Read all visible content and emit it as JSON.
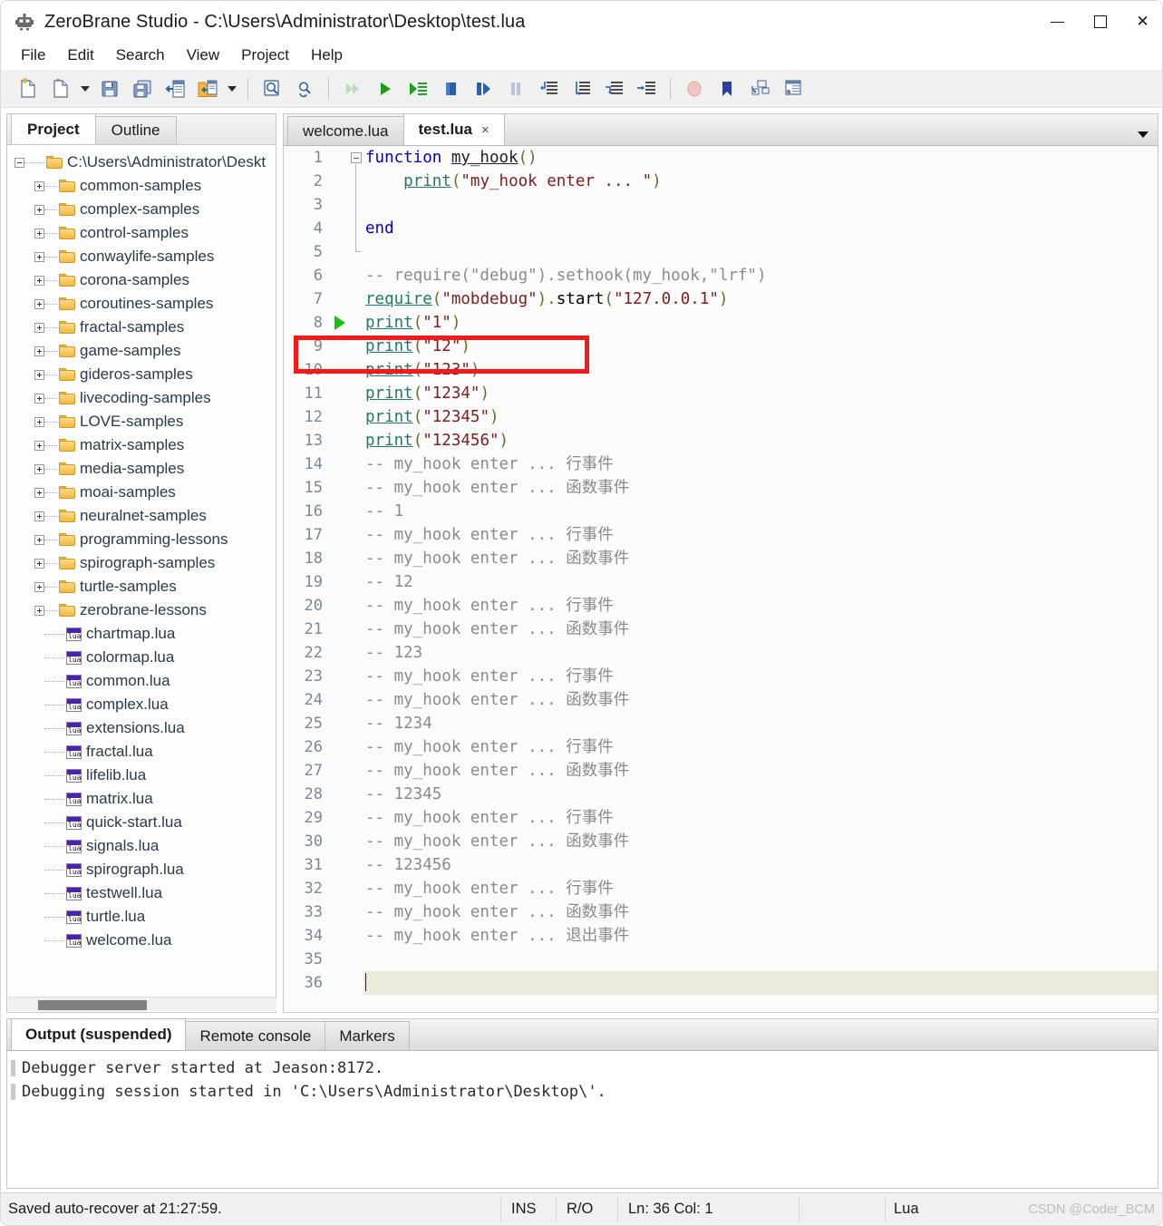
{
  "window": {
    "title": "ZeroBrane Studio - C:\\Users\\Administrator\\Desktop\\test.lua",
    "app_icon": "zerobrane-app-icon",
    "minimize_label": "Minimize",
    "maximize_label": "Maximize",
    "close_label": "Close"
  },
  "menubar": {
    "items": [
      {
        "label": "File"
      },
      {
        "label": "Edit"
      },
      {
        "label": "Search"
      },
      {
        "label": "View"
      },
      {
        "label": "Project"
      },
      {
        "label": "Help"
      }
    ]
  },
  "toolbar": {
    "items": [
      {
        "name": "new-file-icon"
      },
      {
        "name": "open-file-icon"
      },
      {
        "name": "open-file-dropdown-arrow"
      },
      {
        "name": "save-file-icon"
      },
      {
        "name": "save-all-icon"
      },
      {
        "name": "close-page-icon"
      },
      {
        "name": "project-directory-icon"
      },
      {
        "name": "project-directory-dropdown-arrow"
      },
      {
        "name": "separator"
      },
      {
        "name": "find-icon"
      },
      {
        "name": "replace-icon"
      },
      {
        "name": "separator"
      },
      {
        "name": "run-icon"
      },
      {
        "name": "start-debugging-icon"
      },
      {
        "name": "step-into-icon"
      },
      {
        "name": "stop-debugging-icon"
      },
      {
        "name": "step-over-icon"
      },
      {
        "name": "break-icon"
      },
      {
        "name": "step-out-icon"
      },
      {
        "name": "trace-icon"
      },
      {
        "name": "run-to-cursor-icon"
      },
      {
        "name": "jump-to-line-icon"
      },
      {
        "name": "separator"
      },
      {
        "name": "toggle-breakpoint-icon"
      },
      {
        "name": "bookmark-icon"
      },
      {
        "name": "stack-view-icon"
      },
      {
        "name": "watch-view-icon"
      }
    ]
  },
  "left_panel": {
    "tabs": [
      {
        "label": "Project",
        "active": true
      },
      {
        "label": "Outline",
        "active": false
      }
    ],
    "tree": {
      "root": {
        "label": "C:\\Users\\Administrator\\Deskt",
        "icon": "folder-icon",
        "state": "expanded"
      },
      "folders": [
        {
          "label": "common-samples"
        },
        {
          "label": "complex-samples"
        },
        {
          "label": "control-samples"
        },
        {
          "label": "conwaylife-samples"
        },
        {
          "label": "corona-samples"
        },
        {
          "label": "coroutines-samples"
        },
        {
          "label": "fractal-samples"
        },
        {
          "label": "game-samples"
        },
        {
          "label": "gideros-samples"
        },
        {
          "label": "livecoding-samples"
        },
        {
          "label": "LOVE-samples"
        },
        {
          "label": "matrix-samples"
        },
        {
          "label": "media-samples"
        },
        {
          "label": "moai-samples"
        },
        {
          "label": "neuralnet-samples"
        },
        {
          "label": "programming-lessons"
        },
        {
          "label": "spirograph-samples"
        },
        {
          "label": "turtle-samples"
        },
        {
          "label": "zerobrane-lessons"
        }
      ],
      "files": [
        {
          "label": "chartmap.lua"
        },
        {
          "label": "colormap.lua"
        },
        {
          "label": "common.lua"
        },
        {
          "label": "complex.lua"
        },
        {
          "label": "extensions.lua"
        },
        {
          "label": "fractal.lua"
        },
        {
          "label": "lifelib.lua"
        },
        {
          "label": "matrix.lua"
        },
        {
          "label": "quick-start.lua"
        },
        {
          "label": "signals.lua"
        },
        {
          "label": "spirograph.lua"
        },
        {
          "label": "testwell.lua"
        },
        {
          "label": "turtle.lua"
        },
        {
          "label": "welcome.lua"
        }
      ]
    }
  },
  "editor": {
    "tabs": [
      {
        "label": "welcome.lua",
        "active": false,
        "closable": false
      },
      {
        "label": "test.lua",
        "active": true,
        "closable": true,
        "close_glyph": "×"
      }
    ],
    "tab_dropdown": "chevron-down-icon",
    "lines": [
      {
        "n": 1,
        "marker": "fold-open",
        "tokens": [
          {
            "t": "function ",
            "c": "k"
          },
          {
            "t": "my_hook",
            "c": "id"
          },
          {
            "t": "()",
            "c": "pn"
          }
        ]
      },
      {
        "n": 2,
        "tokens": [
          {
            "t": "    ",
            "c": "sp"
          },
          {
            "t": "print",
            "c": "fn"
          },
          {
            "t": "(",
            "c": "pn"
          },
          {
            "t": "\"my_hook enter ... \"",
            "c": "st"
          },
          {
            "t": ")",
            "c": "pn"
          }
        ]
      },
      {
        "n": 3,
        "tokens": []
      },
      {
        "n": 4,
        "tokens": [
          {
            "t": "end",
            "c": "k"
          }
        ]
      },
      {
        "n": 5,
        "tokens": []
      },
      {
        "n": 6,
        "tokens": [
          {
            "t": "-- require(\"debug\").sethook(my_hook,\"lrf\")",
            "c": "cm"
          }
        ]
      },
      {
        "n": 7,
        "tokens": [
          {
            "t": "require",
            "c": "fn"
          },
          {
            "t": "(",
            "c": "pn"
          },
          {
            "t": "\"mobdebug\"",
            "c": "st"
          },
          {
            "t": ").",
            "c": "pn"
          },
          {
            "t": "start",
            "c": "plain"
          },
          {
            "t": "(",
            "c": "pn"
          },
          {
            "t": "\"127.0.0.1\"",
            "c": "st"
          },
          {
            "t": ")",
            "c": "pn"
          }
        ]
      },
      {
        "n": 8,
        "marker": "debug-current-line",
        "tokens": [
          {
            "t": "print",
            "c": "fn"
          },
          {
            "t": "(",
            "c": "pn"
          },
          {
            "t": "\"1\"",
            "c": "st"
          },
          {
            "t": ")",
            "c": "pn"
          }
        ]
      },
      {
        "n": 9,
        "tokens": [
          {
            "t": "print",
            "c": "fn"
          },
          {
            "t": "(",
            "c": "pn"
          },
          {
            "t": "\"12\"",
            "c": "st"
          },
          {
            "t": ")",
            "c": "pn"
          }
        ]
      },
      {
        "n": 10,
        "tokens": [
          {
            "t": "print",
            "c": "fn"
          },
          {
            "t": "(",
            "c": "pn"
          },
          {
            "t": "\"123\"",
            "c": "st"
          },
          {
            "t": ")",
            "c": "pn"
          }
        ]
      },
      {
        "n": 11,
        "tokens": [
          {
            "t": "print",
            "c": "fn"
          },
          {
            "t": "(",
            "c": "pn"
          },
          {
            "t": "\"1234\"",
            "c": "st"
          },
          {
            "t": ")",
            "c": "pn"
          }
        ]
      },
      {
        "n": 12,
        "tokens": [
          {
            "t": "print",
            "c": "fn"
          },
          {
            "t": "(",
            "c": "pn"
          },
          {
            "t": "\"12345\"",
            "c": "st"
          },
          {
            "t": ")",
            "c": "pn"
          }
        ]
      },
      {
        "n": 13,
        "tokens": [
          {
            "t": "print",
            "c": "fn"
          },
          {
            "t": "(",
            "c": "pn"
          },
          {
            "t": "\"123456\"",
            "c": "st"
          },
          {
            "t": ")",
            "c": "pn"
          }
        ]
      },
      {
        "n": 14,
        "tokens": [
          {
            "t": "-- my_hook enter ... 行事件",
            "c": "cm"
          }
        ]
      },
      {
        "n": 15,
        "tokens": [
          {
            "t": "-- my_hook enter ... 函数事件",
            "c": "cm"
          }
        ]
      },
      {
        "n": 16,
        "tokens": [
          {
            "t": "-- 1",
            "c": "cm"
          }
        ]
      },
      {
        "n": 17,
        "tokens": [
          {
            "t": "-- my_hook enter ... 行事件",
            "c": "cm"
          }
        ]
      },
      {
        "n": 18,
        "tokens": [
          {
            "t": "-- my_hook enter ... 函数事件",
            "c": "cm"
          }
        ]
      },
      {
        "n": 19,
        "tokens": [
          {
            "t": "-- 12",
            "c": "cm"
          }
        ]
      },
      {
        "n": 20,
        "tokens": [
          {
            "t": "-- my_hook enter ... 行事件",
            "c": "cm"
          }
        ]
      },
      {
        "n": 21,
        "tokens": [
          {
            "t": "-- my_hook enter ... 函数事件",
            "c": "cm"
          }
        ]
      },
      {
        "n": 22,
        "tokens": [
          {
            "t": "-- 123",
            "c": "cm"
          }
        ]
      },
      {
        "n": 23,
        "tokens": [
          {
            "t": "-- my_hook enter ... 行事件",
            "c": "cm"
          }
        ]
      },
      {
        "n": 24,
        "tokens": [
          {
            "t": "-- my_hook enter ... 函数事件",
            "c": "cm"
          }
        ]
      },
      {
        "n": 25,
        "tokens": [
          {
            "t": "-- 1234",
            "c": "cm"
          }
        ]
      },
      {
        "n": 26,
        "tokens": [
          {
            "t": "-- my_hook enter ... 行事件",
            "c": "cm"
          }
        ]
      },
      {
        "n": 27,
        "tokens": [
          {
            "t": "-- my_hook enter ... 函数事件",
            "c": "cm"
          }
        ]
      },
      {
        "n": 28,
        "tokens": [
          {
            "t": "-- 12345",
            "c": "cm"
          }
        ]
      },
      {
        "n": 29,
        "tokens": [
          {
            "t": "-- my_hook enter ... 行事件",
            "c": "cm"
          }
        ]
      },
      {
        "n": 30,
        "tokens": [
          {
            "t": "-- my_hook enter ... 函数事件",
            "c": "cm"
          }
        ]
      },
      {
        "n": 31,
        "tokens": [
          {
            "t": "-- 123456",
            "c": "cm"
          }
        ]
      },
      {
        "n": 32,
        "tokens": [
          {
            "t": "-- my_hook enter ... 行事件",
            "c": "cm"
          }
        ]
      },
      {
        "n": 33,
        "tokens": [
          {
            "t": "-- my_hook enter ... 函数事件",
            "c": "cm"
          }
        ]
      },
      {
        "n": 34,
        "tokens": [
          {
            "t": "-- my_hook enter ... 退出事件",
            "c": "cm"
          }
        ]
      },
      {
        "n": 35,
        "tokens": []
      },
      {
        "n": 36,
        "current": true,
        "caret": true,
        "tokens": []
      }
    ],
    "annotation": {
      "type": "red-rectangle-highlight",
      "color": "#f51919",
      "target_line": 8
    }
  },
  "output_panel": {
    "tabs": [
      {
        "label": "Output (suspended)",
        "active": true
      },
      {
        "label": "Remote console",
        "active": false
      },
      {
        "label": "Markers",
        "active": false
      }
    ],
    "lines": [
      "Debugger server started at Jeason:8172.",
      "Debugging session started in 'C:\\Users\\Administrator\\Desktop\\'."
    ]
  },
  "statusbar": {
    "message": "Saved auto-recover at 21:27:59.",
    "insert_mode": "INS",
    "readonly": "R/O",
    "position": "Ln: 36 Col: 1",
    "language": "Lua",
    "watermark": "CSDN @Coder_BCM"
  },
  "colors": {
    "accent_red": "#f51919",
    "keyword": "#0000c8",
    "string": "#7f1d1d",
    "comment": "#8b8b8b",
    "function": "#1f7a6a",
    "debug_marker": "#12c312",
    "toolbar_bg": "#f0f0f0"
  }
}
